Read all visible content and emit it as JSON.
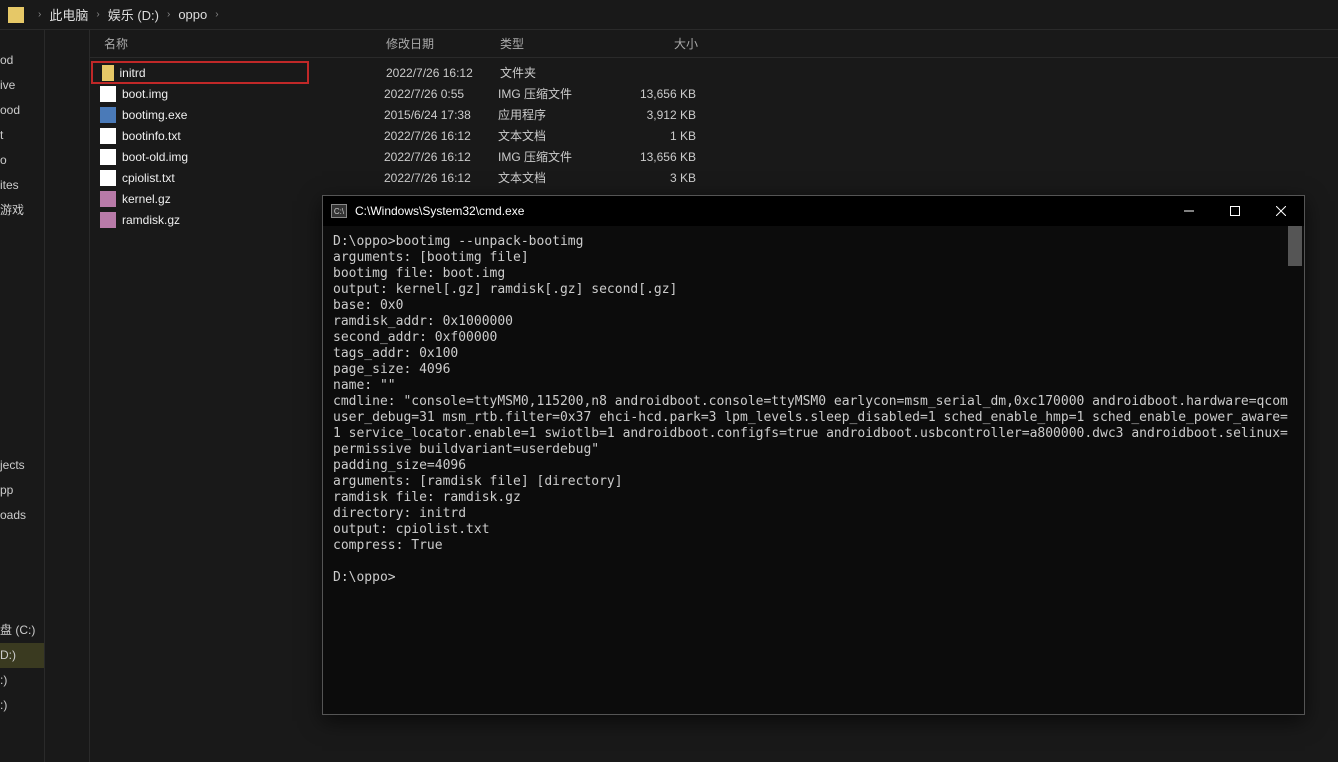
{
  "breadcrumb": {
    "items": [
      "此电脑",
      "娱乐 (D:)",
      "oppo"
    ]
  },
  "sidebar": {
    "top": [
      "od",
      "ive",
      "ood",
      "t",
      "o",
      "ites",
      "游戏"
    ],
    "mid": [
      "jects",
      "pp",
      "oads"
    ],
    "drives": [
      "盘 (C:)",
      "D:)",
      ":)",
      ":)"
    ]
  },
  "columns": {
    "name": "名称",
    "date": "修改日期",
    "type": "类型",
    "size": "大小"
  },
  "files": [
    {
      "name": "initrd",
      "date": "2022/7/26 16:12",
      "type": "文件夹",
      "size": "",
      "icon": "ico-folder",
      "highlight": true
    },
    {
      "name": "boot.img",
      "date": "2022/7/26 0:55",
      "type": "IMG 压缩文件",
      "size": "13,656 KB",
      "icon": "ico-file"
    },
    {
      "name": "bootimg.exe",
      "date": "2015/6/24 17:38",
      "type": "应用程序",
      "size": "3,912 KB",
      "icon": "ico-exe"
    },
    {
      "name": "bootinfo.txt",
      "date": "2022/7/26 16:12",
      "type": "文本文档",
      "size": "1 KB",
      "icon": "ico-file"
    },
    {
      "name": "boot-old.img",
      "date": "2022/7/26 16:12",
      "type": "IMG 压缩文件",
      "size": "13,656 KB",
      "icon": "ico-file"
    },
    {
      "name": "cpiolist.txt",
      "date": "2022/7/26 16:12",
      "type": "文本文档",
      "size": "3 KB",
      "icon": "ico-file"
    },
    {
      "name": "kernel.gz",
      "date": "",
      "type": "",
      "size": "",
      "icon": "ico-gz"
    },
    {
      "name": "ramdisk.gz",
      "date": "",
      "type": "",
      "size": "",
      "icon": "ico-gz"
    }
  ],
  "cmd": {
    "title": "C:\\Windows\\System32\\cmd.exe",
    "output": "D:\\oppo>bootimg --unpack-bootimg\narguments: [bootimg file]\nbootimg file: boot.img\noutput: kernel[.gz] ramdisk[.gz] second[.gz]\nbase: 0x0\nramdisk_addr: 0x1000000\nsecond_addr: 0xf00000\ntags_addr: 0x100\npage_size: 4096\nname: \"\"\ncmdline: \"console=ttyMSM0,115200,n8 androidboot.console=ttyMSM0 earlycon=msm_serial_dm,0xc170000 androidboot.hardware=qcom user_debug=31 msm_rtb.filter=0x37 ehci-hcd.park=3 lpm_levels.sleep_disabled=1 sched_enable_hmp=1 sched_enable_power_aware=1 service_locator.enable=1 swiotlb=1 androidboot.configfs=true androidboot.usbcontroller=a800000.dwc3 androidboot.selinux=permissive buildvariant=userdebug\"\npadding_size=4096\narguments: [ramdisk file] [directory]\nramdisk file: ramdisk.gz\ndirectory: initrd\noutput: cpiolist.txt\ncompress: True\n\nD:\\oppo>"
  }
}
